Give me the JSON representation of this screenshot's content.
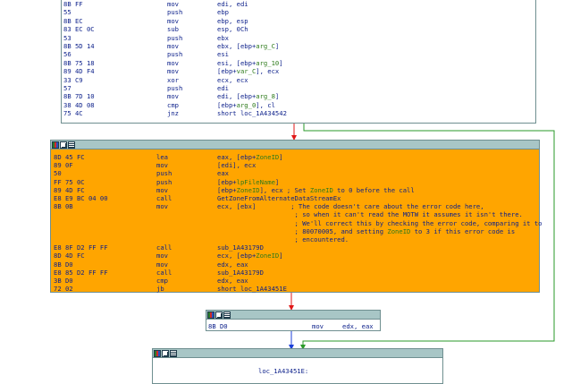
{
  "top_block": {
    "rows": [
      {
        "bytes": "8B FF",
        "mn": "mov",
        "op": "edi, edi"
      },
      {
        "bytes": "55",
        "mn": "push",
        "op": "ebp"
      },
      {
        "bytes": "8B EC",
        "mn": "mov",
        "op": "ebp, esp"
      },
      {
        "bytes": "83 EC 0C",
        "mn": "sub",
        "op": "esp, 0Ch"
      },
      {
        "bytes": "53",
        "mn": "push",
        "op": "ebx"
      },
      {
        "bytes": "8B 5D 14",
        "mn": "mov",
        "op": "ebx, [ebp+arg_C]"
      },
      {
        "bytes": "56",
        "mn": "push",
        "op": "esi"
      },
      {
        "bytes": "8B 75 18",
        "mn": "mov",
        "op": "esi, [ebp+arg_10]"
      },
      {
        "bytes": "89 4D F4",
        "mn": "mov",
        "op": "[ebp+var_C], ecx"
      },
      {
        "bytes": "33 C9",
        "mn": "xor",
        "op": "ecx, ecx"
      },
      {
        "bytes": "57",
        "mn": "push",
        "op": "edi"
      },
      {
        "bytes": "8B 7D 10",
        "mn": "mov",
        "op": "edi, [ebp+arg_8]"
      },
      {
        "bytes": "38 4D 08",
        "mn": "cmp",
        "op": "[ebp+arg_0], cl"
      },
      {
        "bytes": "75 4C",
        "mn": "jnz",
        "op": "short loc_1A434542"
      }
    ]
  },
  "orange_block": {
    "rows": [
      {
        "bytes": "8D 45 FC",
        "mn": "lea",
        "op": "eax, [ebp+ZoneID]"
      },
      {
        "bytes": "89 0F",
        "mn": "mov",
        "op": "[edi], ecx"
      },
      {
        "bytes": "50",
        "mn": "push",
        "op": "eax"
      },
      {
        "bytes": "FF 75 0C",
        "mn": "push",
        "op": "[ebp+lpFileName]"
      },
      {
        "bytes": "89 4D FC",
        "mn": "mov",
        "op": "[ebp+ZoneID], ecx ; Set ZoneID to 0 before the call"
      },
      {
        "bytes": "E8 E9 BC 04 00",
        "mn": "call",
        "op": "GetZoneFromAlternateDataStreamEx"
      },
      {
        "bytes": "8B 0B",
        "mn": "mov",
        "op": "ecx, [ebx]         ; The code doesn't care about the error code here,"
      },
      {
        "bytes": "",
        "mn": "",
        "op": "                    ; so when it can't read the MOTW it assumes it isn't there."
      },
      {
        "bytes": "",
        "mn": "",
        "op": "                    ; We'll correct this by checking the error code, comparing it to"
      },
      {
        "bytes": "",
        "mn": "",
        "op": "                    ; 80070005, and setting ZoneID to 3 if this error code is"
      },
      {
        "bytes": "",
        "mn": "",
        "op": "                    ; encountered."
      },
      {
        "bytes": "E8 8F D2 FF FF",
        "mn": "call",
        "op": "sub_1A43179D"
      },
      {
        "bytes": "8D 4D FC",
        "mn": "mov",
        "op": "ecx, [ebp+ZoneID]"
      },
      {
        "bytes": "8B D0",
        "mn": "mov",
        "op": "edx, eax"
      },
      {
        "bytes": "E8 85 D2 FF FF",
        "mn": "call",
        "op": "sub_1A43179D"
      },
      {
        "bytes": "3B D0",
        "mn": "cmp",
        "op": "edx, eax"
      },
      {
        "bytes": "72 02",
        "mn": "jb",
        "op": "short loc_1A43451E"
      }
    ]
  },
  "small_block": {
    "rows": [
      {
        "bytes": "8B D0",
        "mn": "mov",
        "op": "edx, eax"
      }
    ]
  },
  "bottom_block": {
    "label": "loc_1A43451E:"
  },
  "colors": {
    "orange_bg": "#ffa500",
    "edge_green": "#2a9a2a",
    "edge_red": "#e01818",
    "edge_blue": "#1b3fd8",
    "titlebar": "#a8c6c6"
  }
}
